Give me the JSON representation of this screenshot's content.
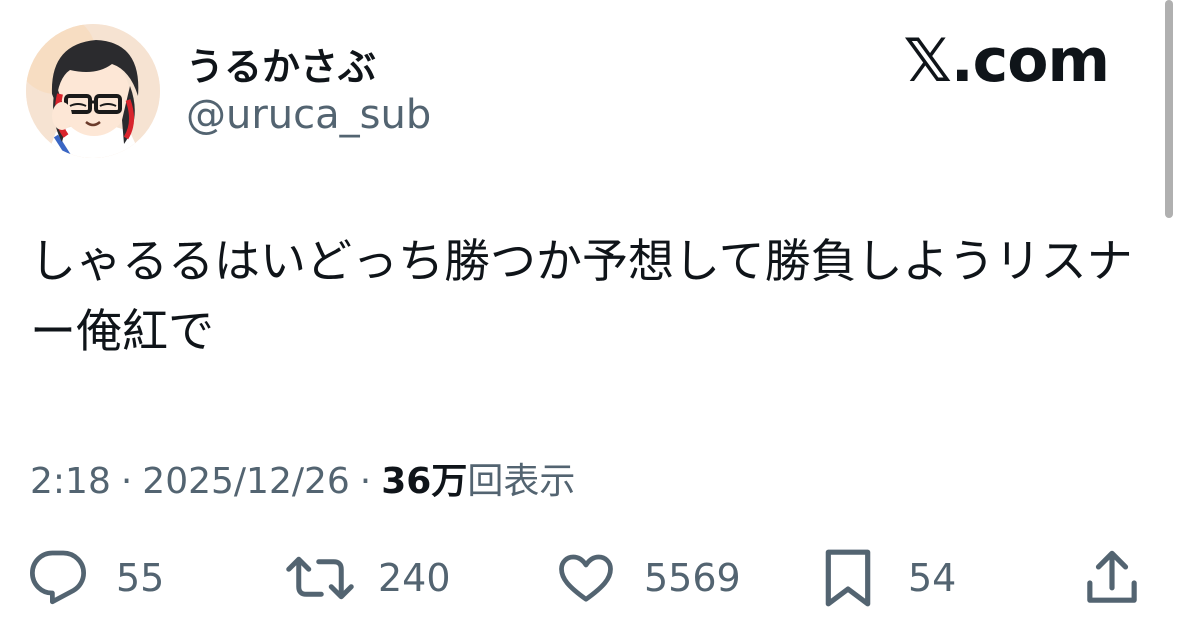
{
  "user": {
    "display_name": "うるかさぶ",
    "handle": "@uruca_sub"
  },
  "brand": "𝕏.com",
  "tweet": {
    "text": "しゃるるはいどっち勝つか予想して勝負しようリスナー俺紅で"
  },
  "meta": {
    "time": "2:18",
    "separator": "·",
    "date": "2025/12/26",
    "views_count": "36万",
    "views_label": "回表示"
  },
  "actions": {
    "replies": "55",
    "reposts": "240",
    "likes": "5569",
    "bookmarks": "54"
  },
  "colors": {
    "text": "#0f1419",
    "secondary": "#536471"
  },
  "icons": [
    "reply-icon",
    "repost-icon",
    "like-icon",
    "bookmark-icon",
    "share-icon"
  ]
}
